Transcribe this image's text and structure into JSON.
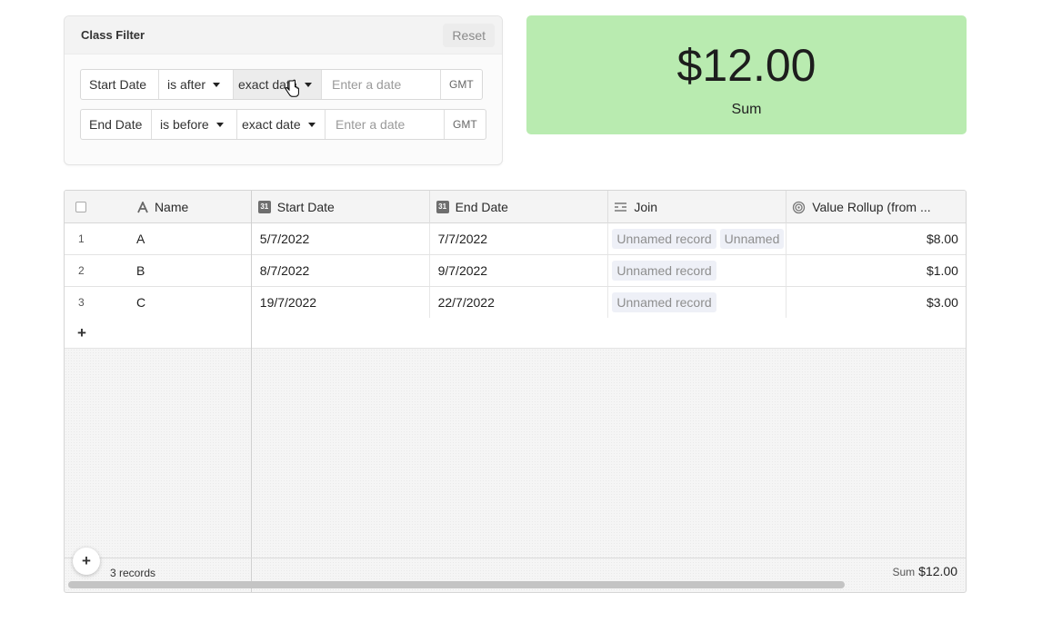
{
  "filter": {
    "title": "Class Filter",
    "reset_label": "Reset",
    "rows": [
      {
        "field": "Start Date",
        "operator": "is after",
        "mode": "exact date",
        "placeholder": "Enter a date",
        "timezone": "GMT"
      },
      {
        "field": "End Date",
        "operator": "is before",
        "mode": "exact date",
        "placeholder": "Enter a date",
        "timezone": "GMT"
      }
    ]
  },
  "summary": {
    "value": "$12.00",
    "label": "Sum",
    "color": "#b9ebb0"
  },
  "grid": {
    "columns": [
      {
        "label": "Name",
        "icon": "text-field-icon"
      },
      {
        "label": "Start Date",
        "icon": "calendar-icon",
        "icon_text": "31"
      },
      {
        "label": "End Date",
        "icon": "calendar-icon",
        "icon_text": "31"
      },
      {
        "label": "Join",
        "icon": "linked-records-icon"
      },
      {
        "label": "Value Rollup (from ...",
        "icon": "rollup-icon"
      }
    ],
    "rows": [
      {
        "num": "1",
        "name": "A",
        "start": "5/7/2022",
        "end": "7/7/2022",
        "join": [
          "Unnamed record",
          "Unnamed"
        ],
        "value": "$8.00"
      },
      {
        "num": "2",
        "name": "B",
        "start": "8/7/2022",
        "end": "9/7/2022",
        "join": [
          "Unnamed record"
        ],
        "value": "$1.00"
      },
      {
        "num": "3",
        "name": "C",
        "start": "19/7/2022",
        "end": "22/7/2022",
        "join": [
          "Unnamed record"
        ],
        "value": "$3.00"
      }
    ],
    "add_row_label": "+",
    "footer": {
      "records": "3 records",
      "sum_label": "Sum",
      "sum_value": "$12.00"
    }
  }
}
